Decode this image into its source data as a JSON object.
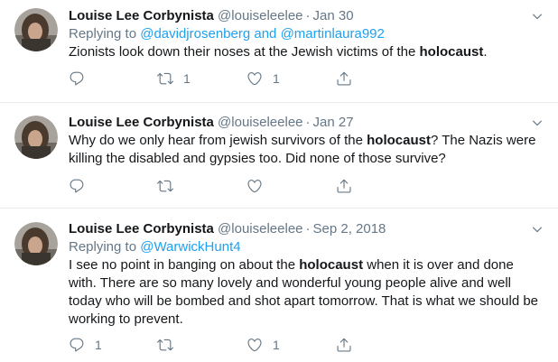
{
  "tweets": [
    {
      "name": "Louise Lee Corbynista",
      "handle": "@louiseleelee",
      "separator": "·",
      "date": "Jan 30",
      "replying_prefix": "Replying to",
      "replying_to_1": "@davidjrosenberg",
      "replying_and": "and",
      "replying_to_2": "@martinlaura992",
      "text_before": "Zionists look down their noses at the Jewish victims of the ",
      "text_bold": "holocaust",
      "text_after": ".",
      "counts": {
        "replies": "",
        "retweets": "1",
        "likes": "1"
      }
    },
    {
      "name": "Louise Lee Corbynista",
      "handle": "@louiseleelee",
      "separator": "·",
      "date": "Jan 27",
      "text_before": "Why do we only hear from jewish survivors of the ",
      "text_bold": "holocaust",
      "text_after": "? The Nazis were killing the disabled and gypsies too. Did none of those survive?",
      "counts": {
        "replies": "",
        "retweets": "",
        "likes": ""
      }
    },
    {
      "name": "Louise Lee Corbynista",
      "handle": "@louiseleelee",
      "separator": "·",
      "date": "Sep 2, 2018",
      "replying_prefix": "Replying to",
      "replying_to_1": "@WarwickHunt4",
      "text_before": "I see no point in banging on about the ",
      "text_bold": "holocaust",
      "text_after": " when it is over and done with. There are so many lovely and wonderful young people alive and well today who will be bombed and shot apart tomorrow. That is what we should be working to prevent.",
      "counts": {
        "replies": "1",
        "retweets": "",
        "likes": "1"
      }
    }
  ],
  "icons": {
    "reply": "reply-icon",
    "retweet": "retweet-icon",
    "like": "heart-icon",
    "share": "share-icon",
    "caret": "chevron-down-icon"
  },
  "colors": {
    "link": "#1da1f2",
    "muted": "#657786",
    "text": "#14171a",
    "divider": "#e6ecf0"
  }
}
